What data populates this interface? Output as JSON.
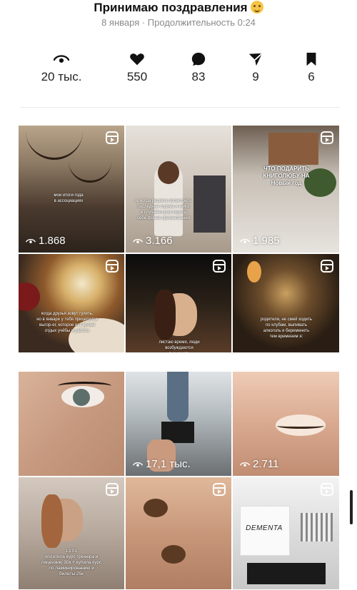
{
  "header": {
    "title": "Принимаю поздравления",
    "title_emoji": "party-face-emoji",
    "subtitle": "8 января · Продолжительность 0:24"
  },
  "stats": [
    {
      "icon": "eye-icon",
      "value": "20 тыс."
    },
    {
      "icon": "heart-icon",
      "value": "550"
    },
    {
      "icon": "comment-icon",
      "value": "83"
    },
    {
      "icon": "share-icon",
      "value": "9"
    },
    {
      "icon": "bookmark-icon",
      "value": "6"
    }
  ],
  "grid_top": [
    {
      "caption": "мои итоги года\nв ассоциациях",
      "views": "1.868",
      "reel": true
    },
    {
      "caption": "я, когда решила посмотреть\nпоследние стрима и книги\nи случайно разглядела\nсебе фонна лрихановения",
      "views": "3.166",
      "reel": false
    },
    {
      "caption": "ЧТО ПОДАРИТЬ\nКНИГОЛЮБУ НА\nНовый год",
      "views": "1.985",
      "reel": true
    },
    {
      "caption": "когда друзья зовут гулять,\nно в январе у тебя прицепится\nвыгор-ег, которое ест время\nотдых учёбы и работы",
      "views": "",
      "reel": true
    },
    {
      "caption": "листаю время, люди\nвозбуждаются\nв эмоциях",
      "views": "",
      "reel": true
    },
    {
      "caption": "родители, не смей ходить\nпо клубам, выпивать\nалкоголь и беременеть\nтем временем я:",
      "views": "",
      "reel": true
    }
  ],
  "grid_bottom": [
    {
      "caption": "",
      "views": "",
      "reel": false
    },
    {
      "caption": "",
      "views": "17,1 тыс.",
      "reel": false
    },
    {
      "caption": "",
      "views": "2.711",
      "reel": false
    },
    {
      "caption": "13:01\nоплатила курс тренера и\nлицензию 30к + купила курс\nпо ламинированию и\nбилеты 25к",
      "views": "",
      "reel": true
    },
    {
      "caption": "",
      "views": "",
      "reel": true
    },
    {
      "caption": "DEMENTA",
      "views": "",
      "reel": true
    }
  ],
  "colors": {
    "text": "#111111",
    "muted": "#8a8a8a",
    "divider": "#ececec"
  }
}
